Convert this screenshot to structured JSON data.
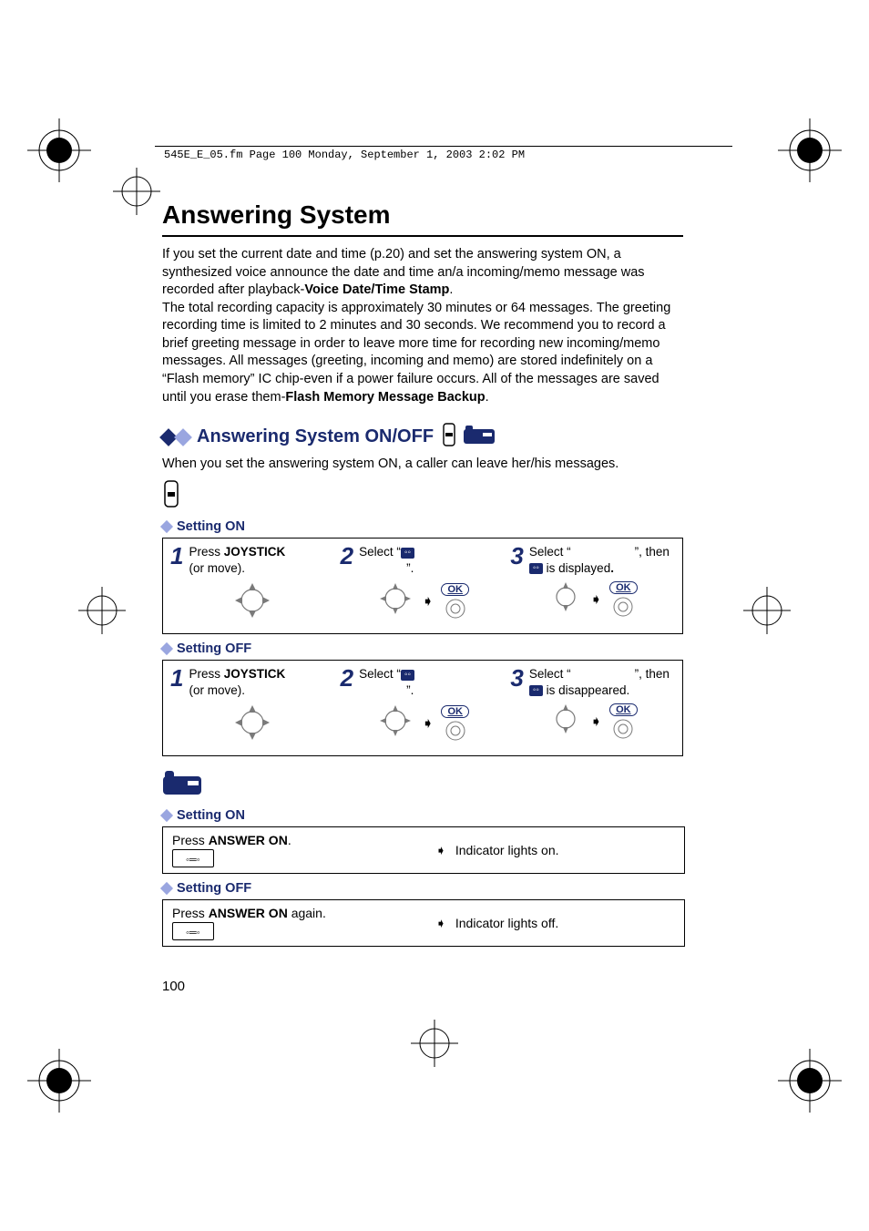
{
  "header_path": "545E_E_05.fm  Page 100  Monday, September 1, 2003  2:02 PM",
  "title": "Answering System",
  "intro_part1": "If you set the current date and time (p.20) and set the answering system ON, a synthesized voice announce the date and time an/a incoming/memo message was recorded after playback-",
  "intro_bold1": "Voice Date/Time Stamp",
  "intro_part1_end": ".",
  "intro_part2": "The total recording capacity is approximately 30 minutes or 64 messages. The greeting recording time is limited to 2 minutes and 30 seconds. We recommend you to record a brief greeting message in order to leave more time for recording new incoming/memo messages. All messages (greeting, incoming and memo) are stored indefinitely on a “Flash memory” IC chip-even if a power failure occurs. All of the messages are saved until you erase them-",
  "intro_bold2": "Flash Memory Message Backup",
  "intro_part2_end": ".",
  "section_title": "Answering System ON/OFF",
  "section_sub": "When you set the answering system ON, a caller can leave her/his messages.",
  "setting_on_label": "Setting ON",
  "setting_off_label": "Setting OFF",
  "ok_label": "OK",
  "handset_on_steps": {
    "s1": {
      "num": "1",
      "line1": "Press ",
      "bold": "JOYSTICK",
      "line2": "(or move)."
    },
    "s2": {
      "num": "2",
      "pre": "Select “",
      "post": "”."
    },
    "s3": {
      "num": "3",
      "pre": "Select “",
      "mid": "”, then ",
      "post": " is displayed",
      "tail": "."
    }
  },
  "handset_off_steps": {
    "s1": {
      "num": "1",
      "line1": "Press ",
      "bold": "JOYSTICK",
      "line2": "(or move)."
    },
    "s2": {
      "num": "2",
      "pre": "Select “",
      "post": "”."
    },
    "s3": {
      "num": "3",
      "pre": "Select “",
      "mid": "”, then ",
      "post": " is disappeared."
    }
  },
  "base_on": {
    "press": "Press ",
    "bold": "ANSWER ON",
    "tail": ".",
    "indicator": "Indicator lights on."
  },
  "base_off": {
    "press": "Press ",
    "bold": "ANSWER ON",
    "tail": " again.",
    "indicator": "Indicator lights off."
  },
  "page_number": "100"
}
